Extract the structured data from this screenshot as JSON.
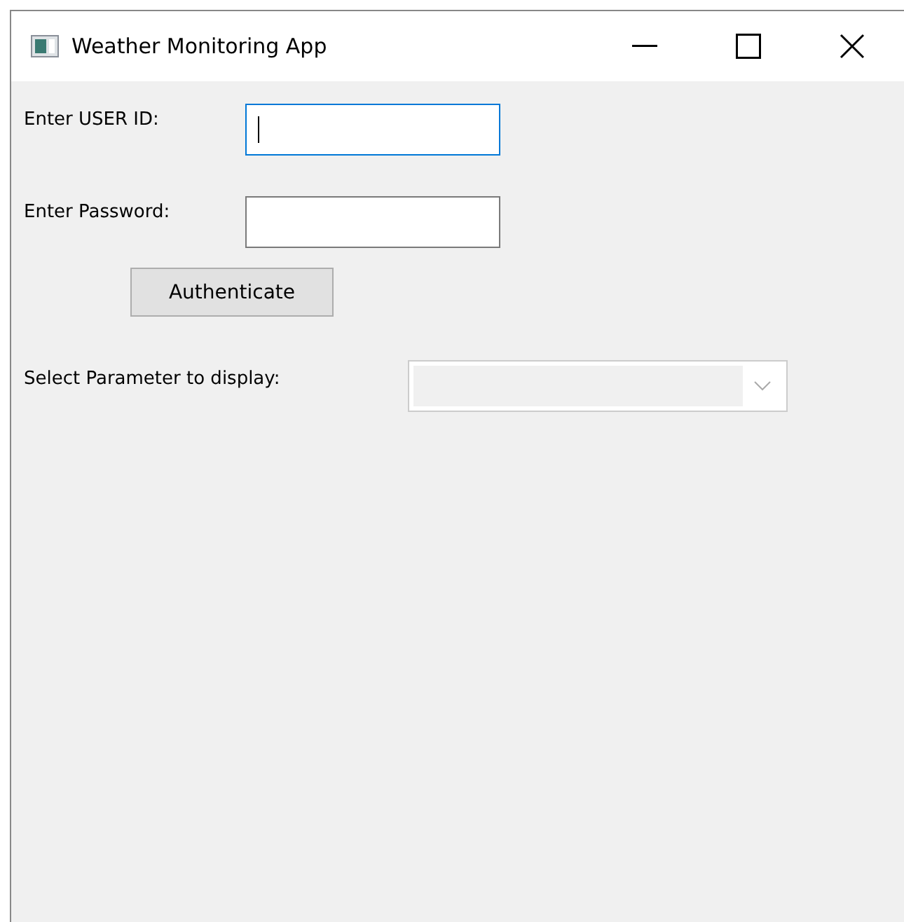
{
  "window": {
    "title": "Weather Monitoring App"
  },
  "user_id": {
    "label": "Enter USER ID:",
    "focused": true
  },
  "password": {
    "label": "Enter Password:",
    "focused": false
  },
  "authenticate_button": {
    "label": "Authenticate"
  },
  "parameter": {
    "label": "Select Parameter to display:",
    "disabled": true
  }
}
